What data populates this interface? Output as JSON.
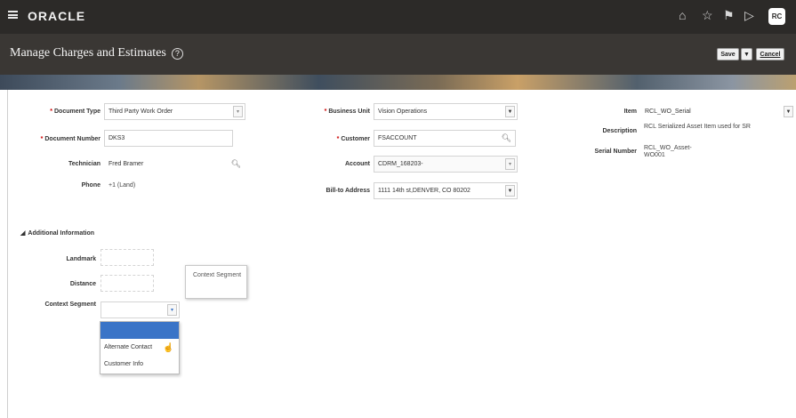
{
  "header": {
    "logo": "ORACLE",
    "icons": [
      "home-icon",
      "favorites-star-icon",
      "flag-icon",
      "play-icon"
    ],
    "avatar_initials": "RC"
  },
  "page": {
    "title": "Manage Charges and Estimates",
    "save_label": "Save",
    "save_dropdown": "▼",
    "cancel_label": "Cancel"
  },
  "form": {
    "document_type": {
      "label": "Document Type",
      "value": "Third Party Work Order"
    },
    "document_number": {
      "label": "Document Number",
      "value": "DKS3"
    },
    "technician": {
      "label": "Technician",
      "value": "Fred Bramer"
    },
    "phone": {
      "label": "Phone",
      "value": "+1 (Land)"
    },
    "business_unit": {
      "label": "Business Unit",
      "value": "Vision Operations"
    },
    "customer": {
      "label": "Customer",
      "value": "FSACCOUNT"
    },
    "account": {
      "label": "Account",
      "value": "CDRM_168203-"
    },
    "bill_to_address": {
      "label": "Bill-to Address",
      "value": "1111 14th st,DENVER, CO 80202"
    },
    "item": {
      "label": "Item",
      "value": "RCL_WO_Serial"
    },
    "description": {
      "label": "Description",
      "value": "RCL Serialized Asset Item used for SR"
    },
    "serial_number": {
      "label": "Serial Number",
      "value": "RCL_WO_Asset-WO001"
    }
  },
  "additional": {
    "section_label": "Additional Information",
    "landmark_label": "Landmark",
    "distance_label": "Distance",
    "context_segment_label": "Context Segment",
    "tooltip_text": "Context Segment",
    "dropdown_options": [
      "",
      "Alternate Contact",
      "Customer Info"
    ]
  },
  "colors": {
    "header_bg": "#2c2a28",
    "title_bg": "#3a3734",
    "required": "#cc0000",
    "dropdown_selected": "#3a74c7"
  }
}
